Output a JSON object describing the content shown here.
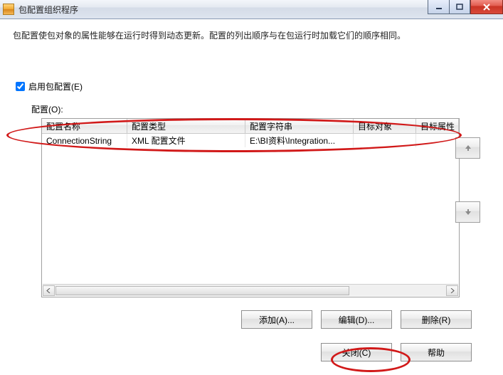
{
  "window": {
    "title": "包配置组织程序"
  },
  "description": "包配置使包对象的属性能够在运行时得到动态更新。配置的列出顺序与在包运行时加载它们的顺序相同。",
  "enable": {
    "label": "启用包配置(E)"
  },
  "config_label": "配置(O):",
  "grid": {
    "headers": {
      "name": "配置名称",
      "type": "配置类型",
      "conn": "配置字符串",
      "target": "目标对象",
      "prop": "目标属性"
    },
    "rows": [
      {
        "name": "ConnectionString",
        "type": "XML 配置文件",
        "conn": "E:\\BI资料\\Integration...",
        "target": "",
        "prop": ""
      }
    ]
  },
  "buttons": {
    "add": "添加(A)...",
    "edit": "编辑(D)...",
    "remove": "删除(R)",
    "close": "关闭(C)",
    "help": "帮助"
  }
}
